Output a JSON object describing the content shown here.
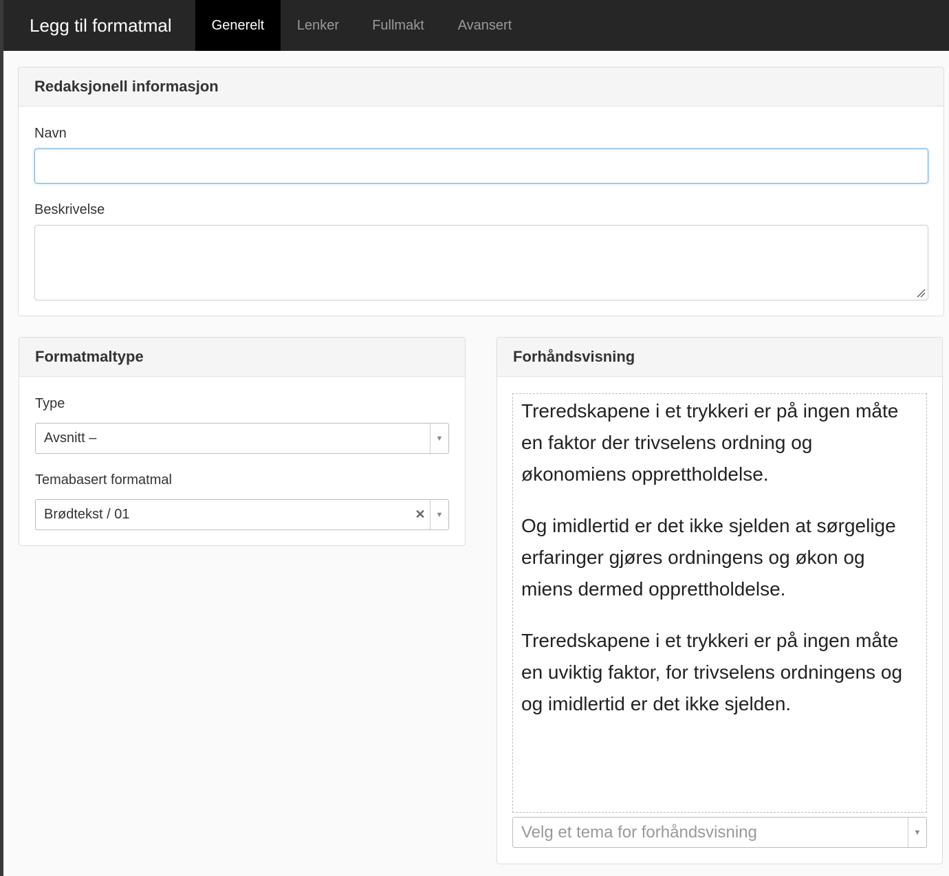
{
  "header": {
    "title": "Legg til formatmal",
    "tabs": [
      {
        "label": "Generelt",
        "active": true
      },
      {
        "label": "Lenker",
        "active": false
      },
      {
        "label": "Fullmakt",
        "active": false
      },
      {
        "label": "Avansert",
        "active": false
      }
    ]
  },
  "editorial": {
    "heading": "Redaksjonell informasjon",
    "name_label": "Navn",
    "name_value": "",
    "description_label": "Beskrivelse",
    "description_value": ""
  },
  "style_type": {
    "heading": "Formatmaltype",
    "type_label": "Type",
    "type_value": "Avsnitt –",
    "theme_label": "Temabasert formatmal",
    "theme_value": "Brødtekst / 01"
  },
  "preview": {
    "heading": "Forhåndsvisning",
    "paragraphs": [
      "Treredskapene i et trykkeri er på ingen måte en faktor der trivselens ordning og økonomiens opprettholdelse.",
      "Og imidlertid er det ikke sjelden at sørgelige erfaringer gjøres ordningens og økon og miens dermed opprettholdelse.",
      "Treredskapene i et trykkeri er på ingen måte en uviktig faktor, for trivselens ordningens og og imidlertid er det ikke sjelden."
    ],
    "theme_placeholder": "Velg et tema for forhåndsvisning"
  },
  "icons": {
    "clear": "close-icon",
    "dropdown": "caret-down-icon",
    "resize": "resize-grip-icon"
  },
  "colors": {
    "topbar": "#262626",
    "active_tab": "#000000",
    "focus_border": "#66afe9"
  }
}
